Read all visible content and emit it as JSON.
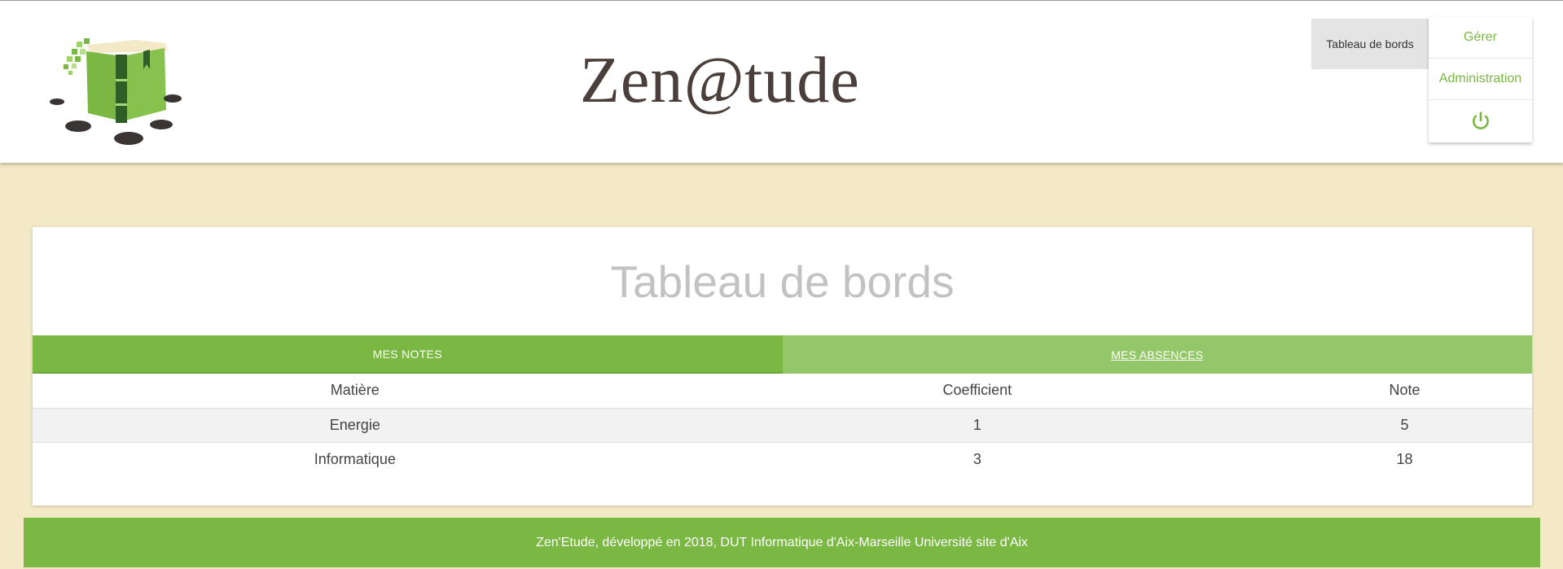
{
  "header": {
    "brand": {
      "prefix": "Zen",
      "at": "@",
      "suffix": "tude"
    },
    "nav_active_label": "Tableau de bords",
    "menu": [
      {
        "label": "Gérer",
        "icon": null
      },
      {
        "label": "Administration",
        "icon": null
      },
      {
        "label": "",
        "icon": "power-icon"
      }
    ]
  },
  "dashboard": {
    "title": "Tableau de bords",
    "tabs": [
      {
        "label": "MES NOTES",
        "active": true
      },
      {
        "label": "MES ABSENCES",
        "active": false
      }
    ],
    "table": {
      "columns": [
        "Matière",
        "Coefficient",
        "Note"
      ],
      "rows": [
        [
          "Energie",
          "1",
          "5"
        ],
        [
          "Informatique",
          "3",
          "18"
        ]
      ]
    }
  },
  "footer": {
    "text": "Zen'Etude, développé en 2018, DUT Informatique d'Aix-Marseille Université site d'Aix"
  },
  "colors": {
    "accent_green": "#7ab843",
    "tab_inactive_green": "#94c76a",
    "page_background": "#f3e9c6",
    "brand_text": "#4a3f3a"
  }
}
